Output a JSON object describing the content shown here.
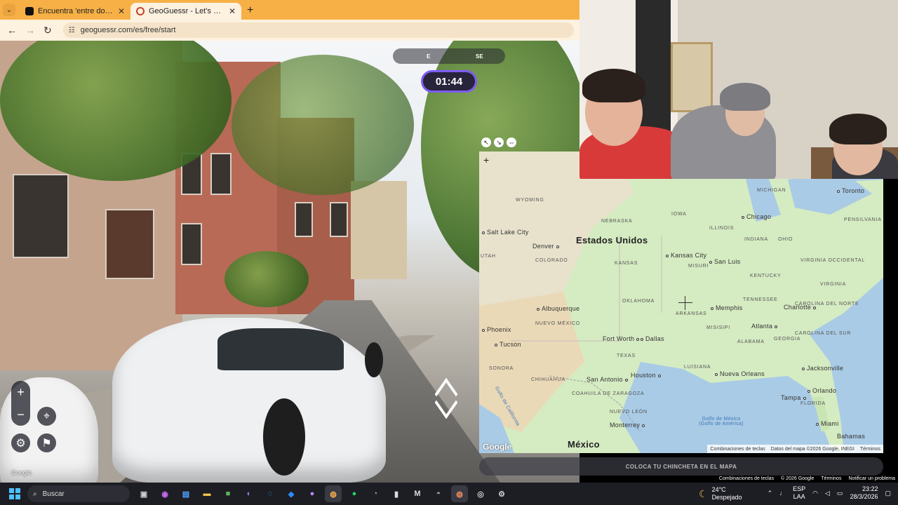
{
  "browser": {
    "tabs": [
      {
        "title": "Encuentra 'entre dos bancos' en",
        "icon": "tiktok-icon"
      },
      {
        "title": "GeoGuessr - Let's explore the w",
        "icon": "geoguessr-icon"
      }
    ],
    "url": "geoguessr.com/es/free/start"
  },
  "game": {
    "compass": {
      "e": "E",
      "se": "SE"
    },
    "timer": "01:44",
    "guess_button": "COLOCA TU CHINCHETA EN EL MAPA",
    "sv_attribution": [
      "Combinaciones de teclas",
      "© 2026 Google",
      "Términos",
      "Notificar un problema"
    ],
    "google_watermark": "Google"
  },
  "map": {
    "country_labels": [
      "Estados Unidos",
      "México"
    ],
    "cities": [
      "Salt Lake City",
      "Denver",
      "Albuquerque",
      "Phoenix",
      "Tucson",
      "Fort Worth",
      "Dallas",
      "Kansas City",
      "San Luis",
      "Chicago",
      "Toronto",
      "Memphis",
      "Charlotte",
      "Atlanta",
      "Jacksonville",
      "Orlando",
      "Tampa",
      "Miami",
      "Houston",
      "San Antonio",
      "Nueva Orleans",
      "Monterrey",
      "Bahamas"
    ],
    "states": [
      "WYOMING",
      "NEBRASKA",
      "IOWA",
      "ILLINOIS",
      "INDIANA",
      "OHIO",
      "MICHIGAN",
      "PENSILVANIA",
      "COLORADO",
      "KANSAS",
      "MISURI",
      "KENTUCKY",
      "VIRGINIA OCCIDENTAL",
      "VIRGINIA",
      "OKLAHOMA",
      "NUEVO MÉXICO",
      "ARKANSAS",
      "TENNESSEE",
      "CAROLINA DEL NORTE",
      "CAROLINA DEL SUR",
      "GEORGIA",
      "ALABAMA",
      "MISISIPI",
      "LUISIANA",
      "TEXAS",
      "FLORIDA",
      "SONORA",
      "CHIHUAHUA",
      "COAHUILA DE ZARAGOZA",
      "NUEVO LEÓN",
      "UTAH",
      "DEL SUR"
    ],
    "water": [
      "Golfo de México (Golfo de América)",
      "Golfo de California"
    ],
    "attribution": [
      "Combinaciones de teclas",
      "Datos del mapa ©2026 Google, INEGI",
      "Términos"
    ],
    "logo": "Google"
  },
  "taskbar": {
    "search_placeholder": "Buscar",
    "weather_temp": "24°C",
    "weather_desc": "Despejado",
    "lang": "ESP",
    "lang2": "LAA",
    "time": "23:22",
    "date": "28/3/2026",
    "apps": [
      "file-icon",
      "copilot-icon",
      "store-icon",
      "folder-icon",
      "minecraft-icon",
      "discord-icon",
      "edge-icon",
      "vscode-icon",
      "github-icon",
      "chrome-icon",
      "spotify-icon",
      "steam-icon",
      "epic-icon",
      "m-icon",
      "steam2-icon",
      "chrome2-icon",
      "obs-icon",
      "settings-icon"
    ]
  }
}
